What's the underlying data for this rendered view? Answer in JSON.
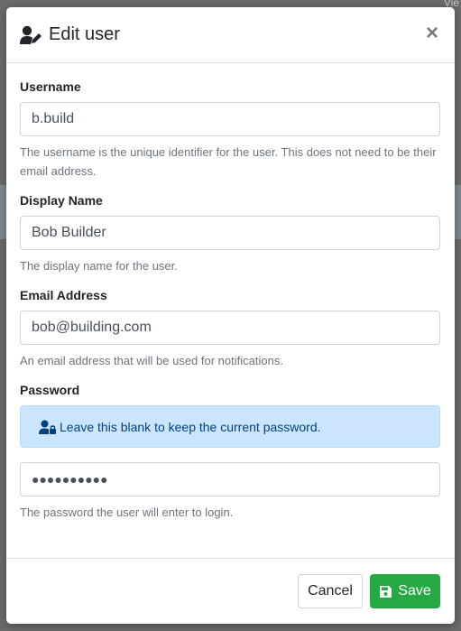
{
  "background": {
    "corner_text": "Vie"
  },
  "modal": {
    "title": "Edit user",
    "close_glyph": "×",
    "title_icon": "user-edit-icon"
  },
  "fields": {
    "username": {
      "label": "Username",
      "value": "b.build",
      "help": "The username is the unique identifier for the user. This does not need to be their email address."
    },
    "display_name": {
      "label": "Display Name",
      "value": "Bob Builder",
      "help": "The display name for the user."
    },
    "email": {
      "label": "Email Address",
      "value": "bob@building.com",
      "help": "An email address that will be used for notifications."
    },
    "password": {
      "label": "Password",
      "alert": "Leave this blank to keep the current password.",
      "value": "●●●●●●●●●●",
      "help": "The password the user will enter to login."
    }
  },
  "footer": {
    "cancel_label": "Cancel",
    "save_label": "Save"
  },
  "colors": {
    "save_button": "#28a745",
    "alert_bg": "#cce5ff",
    "alert_text": "#004085"
  }
}
